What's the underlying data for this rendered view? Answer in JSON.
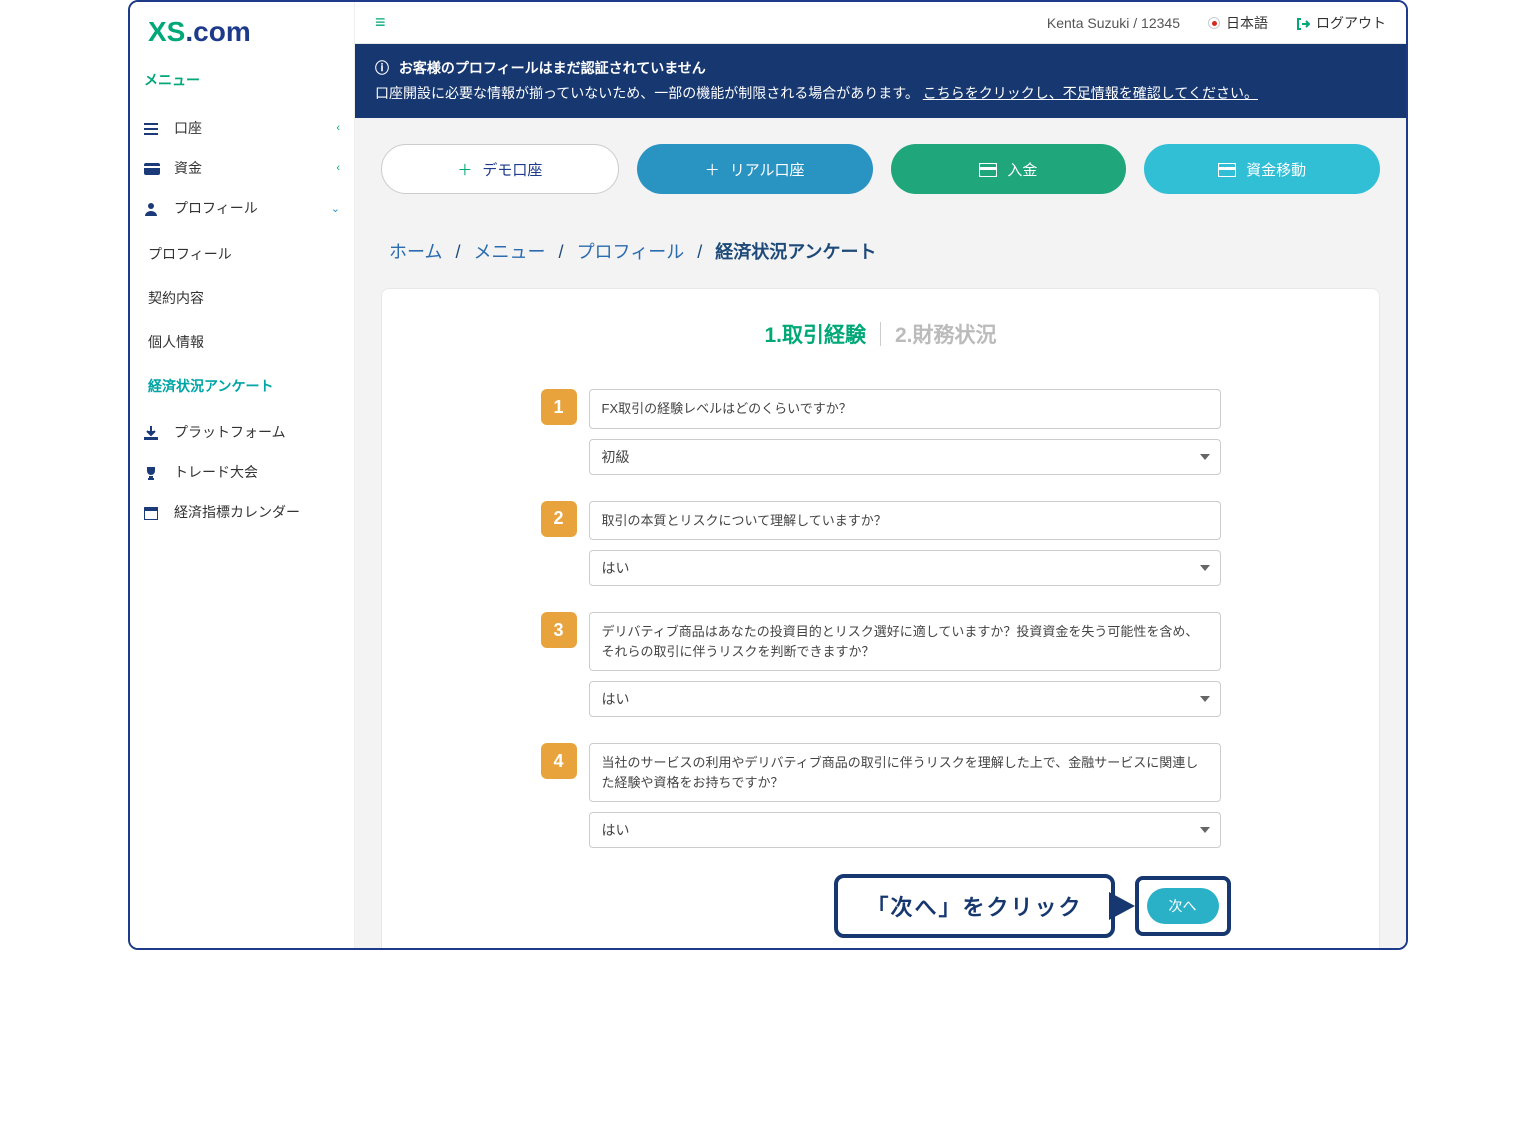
{
  "logo": {
    "xs": "XS",
    "dot": ".",
    "com": "com"
  },
  "sidebar": {
    "menuHeading": "メニュー",
    "items": [
      {
        "label": "口座"
      },
      {
        "label": "資金"
      },
      {
        "label": "プロフィール"
      },
      {
        "label": "プラットフォーム"
      },
      {
        "label": "トレード大会"
      },
      {
        "label": "経済指標カレンダー"
      }
    ],
    "profileSub": [
      {
        "label": "プロフィール"
      },
      {
        "label": "契約内容"
      },
      {
        "label": "個人情報"
      },
      {
        "label": "経済状況アンケート"
      }
    ]
  },
  "topbar": {
    "user": "Kenta Suzuki / 12345",
    "lang": "日本語",
    "logout": "ログアウト"
  },
  "alert": {
    "title": "お客様のプロフィールはまだ認証されていません",
    "body": "口座開設に必要な情報が揃っていないため、一部の機能が制限される場合があります。",
    "link": "こちらをクリックし、不足情報を確認してください。"
  },
  "actions": {
    "demo": "デモ口座",
    "real": "リアル口座",
    "deposit": "入金",
    "transfer": "資金移動"
  },
  "breadcrumb": {
    "home": "ホーム",
    "menu": "メニュー",
    "profile": "プロフィール",
    "current": "経済状況アンケート"
  },
  "steps": {
    "s1": "1.取引経験",
    "s2": "2.財務状況"
  },
  "questions": [
    {
      "n": "1",
      "label": "FX取引の経験レベルはどのくらいですか？",
      "value": "初級"
    },
    {
      "n": "2",
      "label": "取引の本質とリスクについて理解していますか？",
      "value": "はい"
    },
    {
      "n": "3",
      "label": "デリバティブ商品はあなたの投資目的とリスク選好に適していますか？投資資金を失う可能性を含め、それらの取引に伴うリスクを判断できますか？",
      "value": "はい"
    },
    {
      "n": "4",
      "label": "当社のサービスの利用やデリバティブ商品の取引に伴うリスクを理解した上で、金融サービスに関連した経験や資格をお持ちですか？",
      "value": "はい"
    }
  ],
  "next": {
    "button": "次へ",
    "callout": "「次へ」をクリック"
  }
}
